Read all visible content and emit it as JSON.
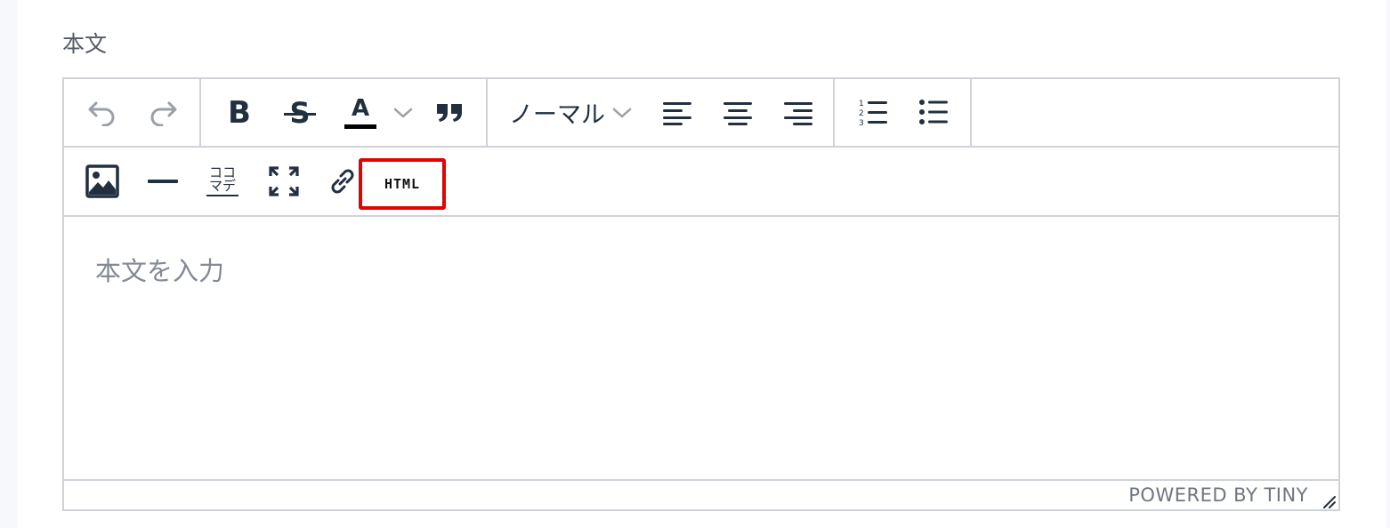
{
  "field": {
    "label": "本文"
  },
  "toolbar": {
    "undo_icon": "undo-icon",
    "redo_icon": "redo-icon",
    "bold_label": "B",
    "strike_label": "S",
    "text_color_label": "A",
    "format_select_value": "ノーマル",
    "html_label": "HTML",
    "furigana_top": "ココ",
    "furigana_bottom": "マデ"
  },
  "editor": {
    "placeholder": "本文を入力",
    "powered_by": "POWERED BY TINY"
  },
  "colors": {
    "icon": "#222f3e",
    "border": "#cfd2d6",
    "highlight": "#e60000"
  }
}
